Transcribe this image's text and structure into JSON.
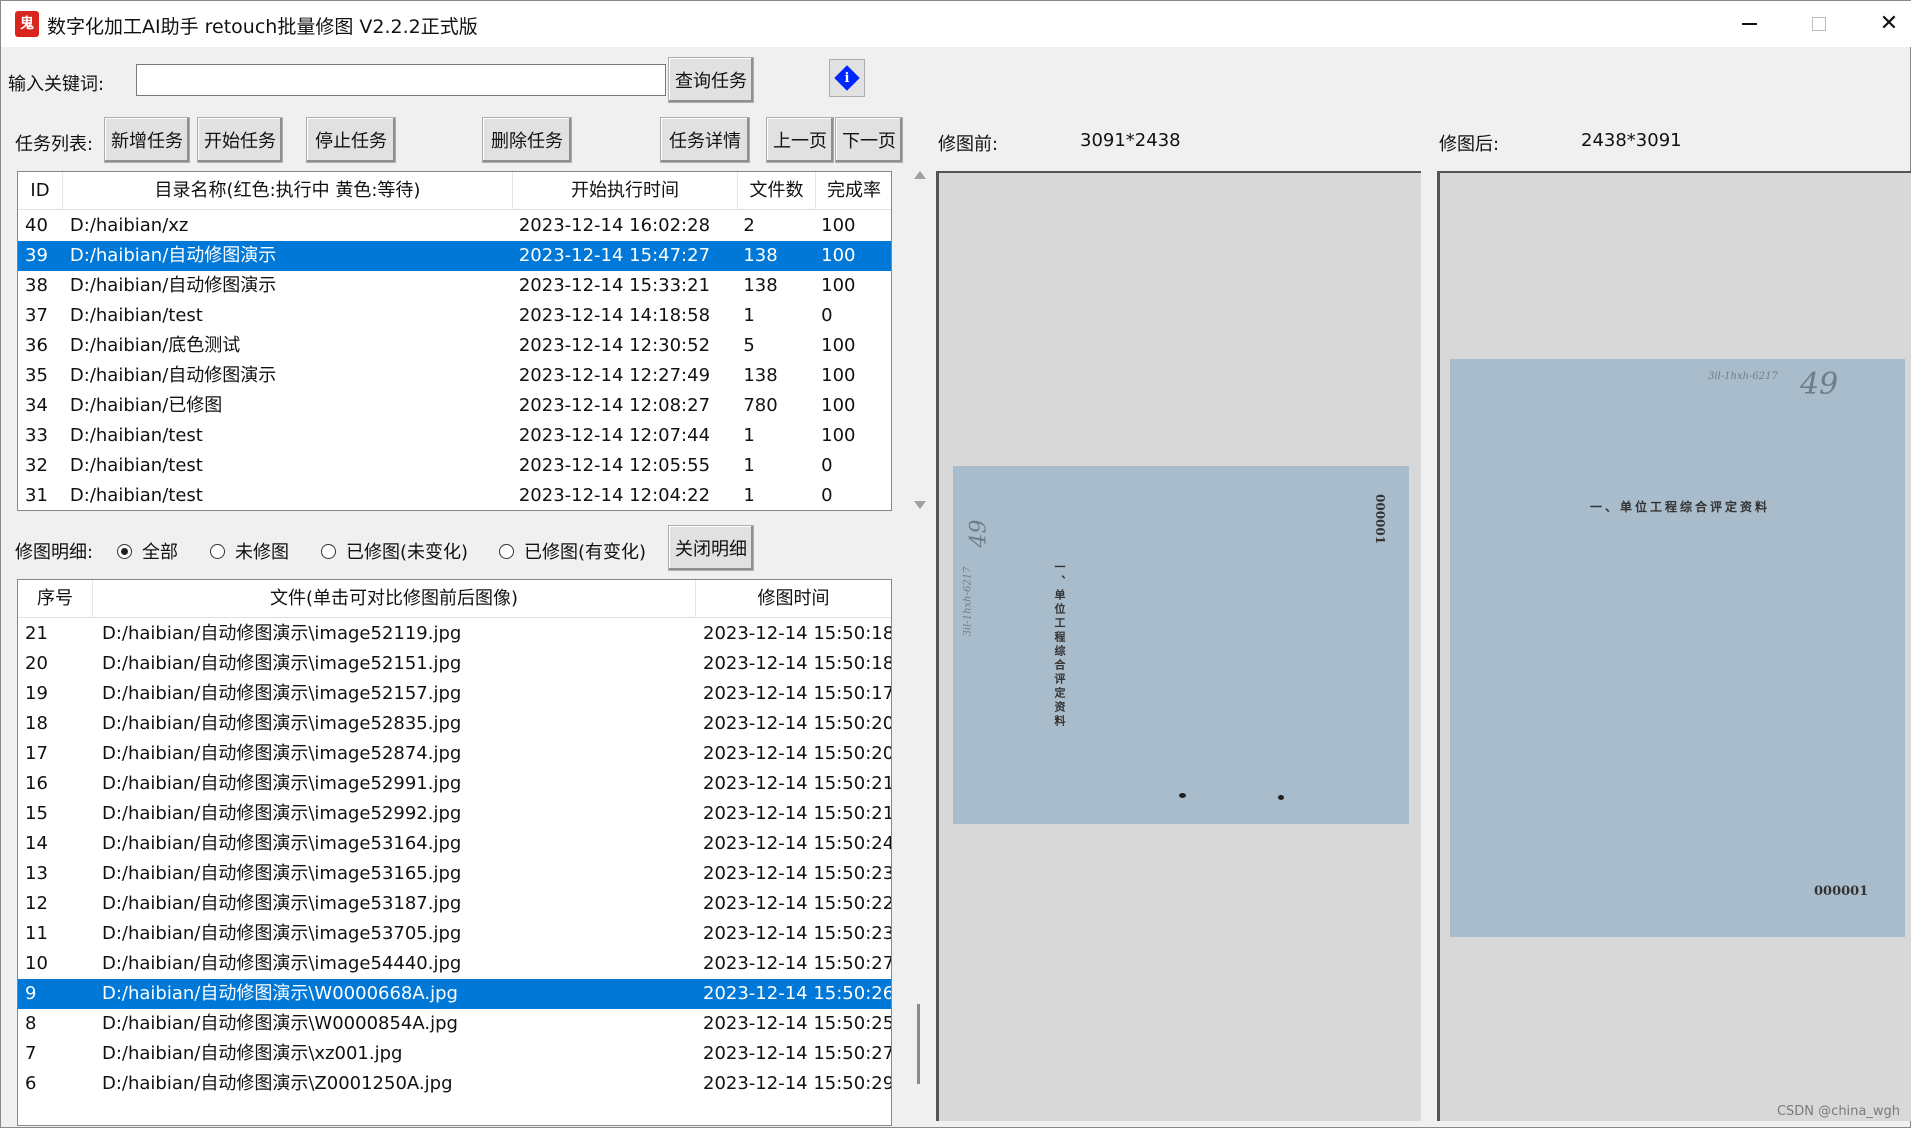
{
  "window": {
    "app_icon_glyph": "鬼",
    "title": "数字化加工AI助手   retouch批量修图 V2.2.2正式版"
  },
  "search": {
    "label": "输入关键词:",
    "value": "",
    "placeholder": "",
    "query_button": "查询任务",
    "info_icon": "i"
  },
  "task_toolbar": {
    "label": "任务列表:",
    "add": "新增任务",
    "start": "开始任务",
    "stop": "停止任务",
    "delete": "删除任务",
    "details": "任务详情",
    "prev": "上一页",
    "next": "下一页"
  },
  "task_table": {
    "columns": [
      "ID",
      "目录名称(红色:执行中 黄色:等待)",
      "开始执行时间",
      "文件数",
      "完成率"
    ],
    "selected_index": 1,
    "rows": [
      {
        "id": "40",
        "dir": "D:/haibian/xz",
        "time": "2023-12-14 16:02:28",
        "files": "2",
        "rate": "100"
      },
      {
        "id": "39",
        "dir": "D:/haibian/自动修图演示",
        "time": "2023-12-14 15:47:27",
        "files": "138",
        "rate": "100"
      },
      {
        "id": "38",
        "dir": "D:/haibian/自动修图演示",
        "time": "2023-12-14 15:33:21",
        "files": "138",
        "rate": "100"
      },
      {
        "id": "37",
        "dir": "D:/haibian/test",
        "time": "2023-12-14 14:18:58",
        "files": "1",
        "rate": "0"
      },
      {
        "id": "36",
        "dir": "D:/haibian/底色测试",
        "time": "2023-12-14 12:30:52",
        "files": "5",
        "rate": "100"
      },
      {
        "id": "35",
        "dir": "D:/haibian/自动修图演示",
        "time": "2023-12-14 12:27:49",
        "files": "138",
        "rate": "100"
      },
      {
        "id": "34",
        "dir": "D:/haibian/已修图",
        "time": "2023-12-14 12:08:27",
        "files": "780",
        "rate": "100"
      },
      {
        "id": "33",
        "dir": "D:/haibian/test",
        "time": "2023-12-14 12:07:44",
        "files": "1",
        "rate": "100"
      },
      {
        "id": "32",
        "dir": "D:/haibian/test",
        "time": "2023-12-14 12:05:55",
        "files": "1",
        "rate": "0"
      },
      {
        "id": "31",
        "dir": "D:/haibian/test",
        "time": "2023-12-14 12:04:22",
        "files": "1",
        "rate": "0"
      }
    ]
  },
  "detail_filter": {
    "label": "修图明细:",
    "options": [
      "全部",
      "未修图",
      "已修图(未变化)",
      "已修图(有变化)"
    ],
    "selected": "全部",
    "close_button": "关闭明细"
  },
  "file_table": {
    "columns": [
      "序号",
      "文件(单击可对比修图前后图像)",
      "修图时间"
    ],
    "selected_index": 12,
    "rows": [
      {
        "no": "21",
        "file": "D:/haibian/自动修图演示\\image52119.jpg",
        "time": "2023-12-14 15:50:18"
      },
      {
        "no": "20",
        "file": "D:/haibian/自动修图演示\\image52151.jpg",
        "time": "2023-12-14 15:50:18"
      },
      {
        "no": "19",
        "file": "D:/haibian/自动修图演示\\image52157.jpg",
        "time": "2023-12-14 15:50:17"
      },
      {
        "no": "18",
        "file": "D:/haibian/自动修图演示\\image52835.jpg",
        "time": "2023-12-14 15:50:20"
      },
      {
        "no": "17",
        "file": "D:/haibian/自动修图演示\\image52874.jpg",
        "time": "2023-12-14 15:50:20"
      },
      {
        "no": "16",
        "file": "D:/haibian/自动修图演示\\image52991.jpg",
        "time": "2023-12-14 15:50:21"
      },
      {
        "no": "15",
        "file": "D:/haibian/自动修图演示\\image52992.jpg",
        "time": "2023-12-14 15:50:21"
      },
      {
        "no": "14",
        "file": "D:/haibian/自动修图演示\\image53164.jpg",
        "time": "2023-12-14 15:50:24"
      },
      {
        "no": "13",
        "file": "D:/haibian/自动修图演示\\image53165.jpg",
        "time": "2023-12-14 15:50:23"
      },
      {
        "no": "12",
        "file": "D:/haibian/自动修图演示\\image53187.jpg",
        "time": "2023-12-14 15:50:22"
      },
      {
        "no": "11",
        "file": "D:/haibian/自动修图演示\\image53705.jpg",
        "time": "2023-12-14 15:50:23"
      },
      {
        "no": "10",
        "file": "D:/haibian/自动修图演示\\image54440.jpg",
        "time": "2023-12-14 15:50:27"
      },
      {
        "no": "9",
        "file": "D:/haibian/自动修图演示\\W0000668A.jpg",
        "time": "2023-12-14 15:50:26"
      },
      {
        "no": "8",
        "file": "D:/haibian/自动修图演示\\W0000854A.jpg",
        "time": "2023-12-14 15:50:25"
      },
      {
        "no": "7",
        "file": "D:/haibian/自动修图演示\\xz001.jpg",
        "time": "2023-12-14 15:50:27"
      },
      {
        "no": "6",
        "file": "D:/haibian/自动修图演示\\Z0001250A.jpg",
        "time": "2023-12-14 15:50:29"
      }
    ]
  },
  "preview": {
    "before_label": "修图前:",
    "before_size": "3091*2438",
    "after_label": "修图后:",
    "after_size": "2438*3091",
    "doc_title": "一、单位工程综合评定资料",
    "doc_number": "000001",
    "doc_handwriting_num": "49",
    "doc_handwriting_code": "3il-1hxh-6217"
  },
  "colors": {
    "selection": "#0078d7",
    "document_blue": "#a9bccb",
    "info_icon": "#0026ff",
    "app_icon": "#d8251d"
  },
  "watermark": "CSDN @china_wgh"
}
